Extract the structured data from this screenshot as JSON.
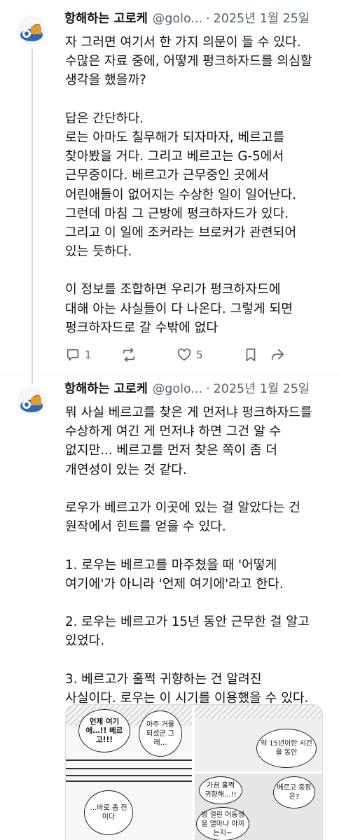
{
  "posts": [
    {
      "author": {
        "name": "항해하는 고로케",
        "handle": "@golo...",
        "date": "2025년 1월 25일",
        "avatar_icon": "goroke-avatar-icon"
      },
      "text_lines": [
        "자 그러면 여기서 한 가지 의문이 들 수 있다.",
        "수많은 자료 중에, 어떻게 펑크하자드를 의심할",
        "생각을 했을까?",
        "",
        "답은 간단하다.",
        "로는 아마도 칠무해가 되자마자, 베르고를",
        "찾아봤을 거다. 그리고 베르고는 G-5에서",
        "근무중이다. 베르고가 근무중인 곳에서",
        "어린애들이 없어지는 수상한 일이 일어난다.",
        "그런데 마침 그 근방에 펑크하자드가 있다.",
        "그리고 이 일에 조커라는 브로커가 관련되어",
        "있는 듯하다.",
        "",
        "이 정보를 조합하면 우리가 펑크하자드에",
        "대해 아는 사실들이 다 나온다. 그렇게 되면",
        "펑크하자드로 갈 수밖에 없다"
      ],
      "actions": {
        "reply_count": "1",
        "repost_count": "",
        "like_count": "5"
      }
    },
    {
      "author": {
        "name": "항해하는 고로케",
        "handle": "@golo...",
        "date": "2025년 1월 25일",
        "avatar_icon": "goroke-avatar-icon"
      },
      "text_lines": [
        "뭐 사실 베르고를 찾은 게 먼저냐 펑크하자드를",
        "수상하게 여긴 게 먼저냐 하면 그건 알 수",
        "없지만... 베르고를 먼저 찾은 쪽이 좀 더",
        "개연성이 있는 것 같다.",
        "",
        "로우가 베르고가 이곳에 있는 걸 알았다는 건",
        "원작에서 힌트를 얻을 수 있다.",
        "",
        "1. 로우는 베르고를 마주쳤을 때 '어떻게",
        "여기에'가 아니라 '언제 여기에'라고 한다.",
        "",
        "2. 로우는 베르고가 15년 동안 근무한 걸 알고",
        "있었다.",
        "",
        "3. 베르고가 훌쩍 귀향하는 건 알려진",
        "사실이다. 로우는 이 시기를 이용했을 수 있다."
      ],
      "manga": {
        "bubble_when_here": "언제 여기에…!! 베르고!!!",
        "bubble_grown": "아주 거물 되셨군 그래…",
        "bubble_recent": "…바로 좀 전이다",
        "bubble_15years": "약 15년이란 시간을 동안",
        "bubble_hometown": "가끔 훌쩍 귀향해…!!",
        "bubble_vergo_post": "베르고 중장은?",
        "bubble_how_many": "벙 걸린 어동생을 얼마나 아끼는지~"
      }
    }
  ],
  "colors": {
    "text": "#0f1419",
    "secondary": "#536471",
    "divider": "#eff3f4"
  }
}
